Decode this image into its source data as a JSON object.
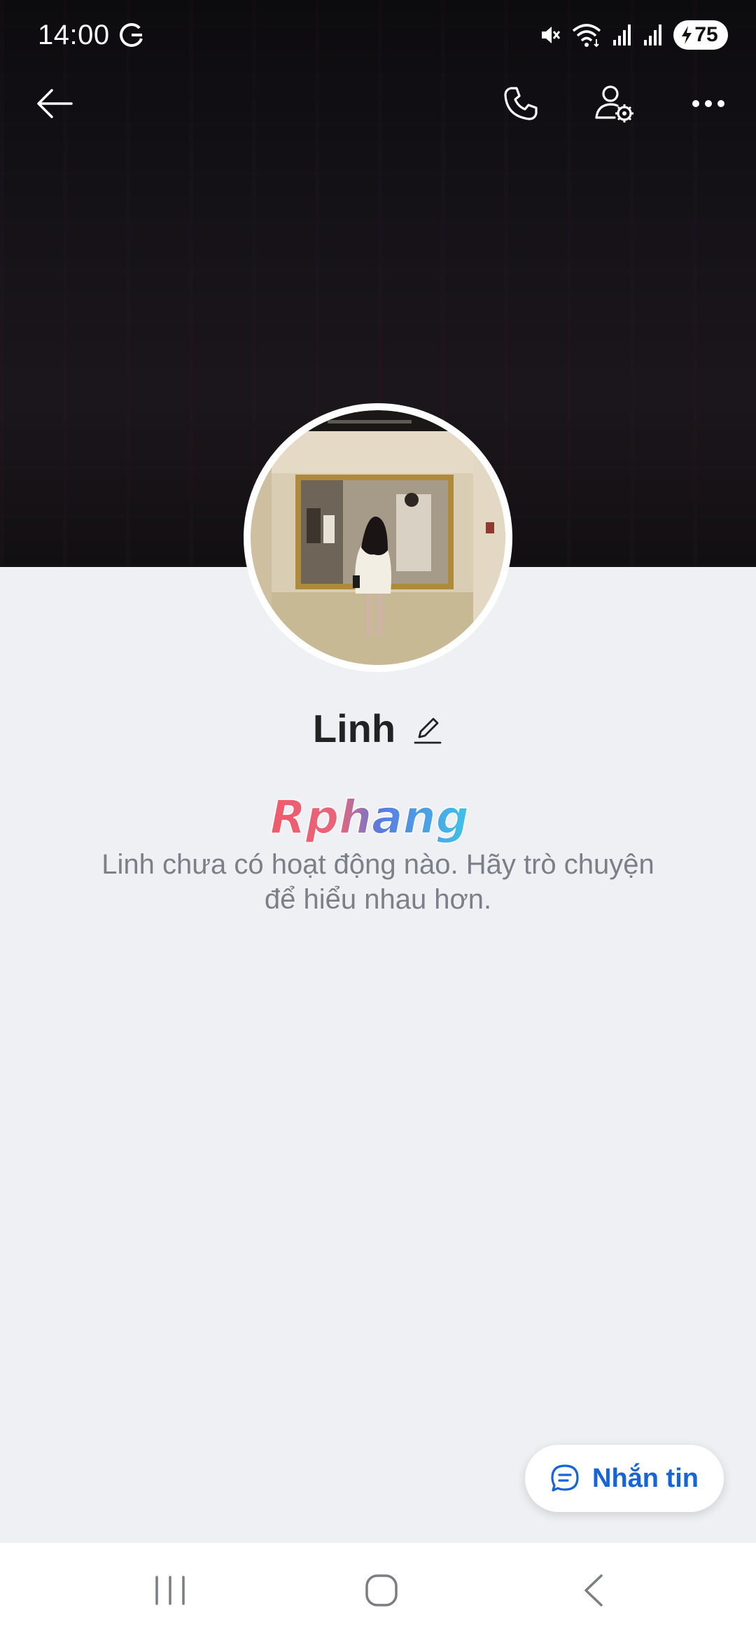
{
  "status_bar": {
    "time": "14:00",
    "battery_level": "75",
    "icons": [
      "google-icon",
      "mute-icon",
      "wifi-icon",
      "signal-icon",
      "signal-icon",
      "charging-icon"
    ]
  },
  "top_bar": {
    "icons": [
      "back-arrow-icon",
      "phone-icon",
      "user-settings-icon",
      "more-icon"
    ]
  },
  "profile": {
    "name": "Linh",
    "empty_message_line1": "Linh chưa có hoạt động nào. Hãy trò chuyện",
    "empty_message_line2": "để hiểu nhau hơn.",
    "watermark": "Rphang"
  },
  "message_button": {
    "label": "Nhắn tin",
    "accent": "#1565d8"
  },
  "nav_bar": {
    "icons": [
      "recent-apps-icon",
      "home-icon",
      "back-icon"
    ]
  }
}
